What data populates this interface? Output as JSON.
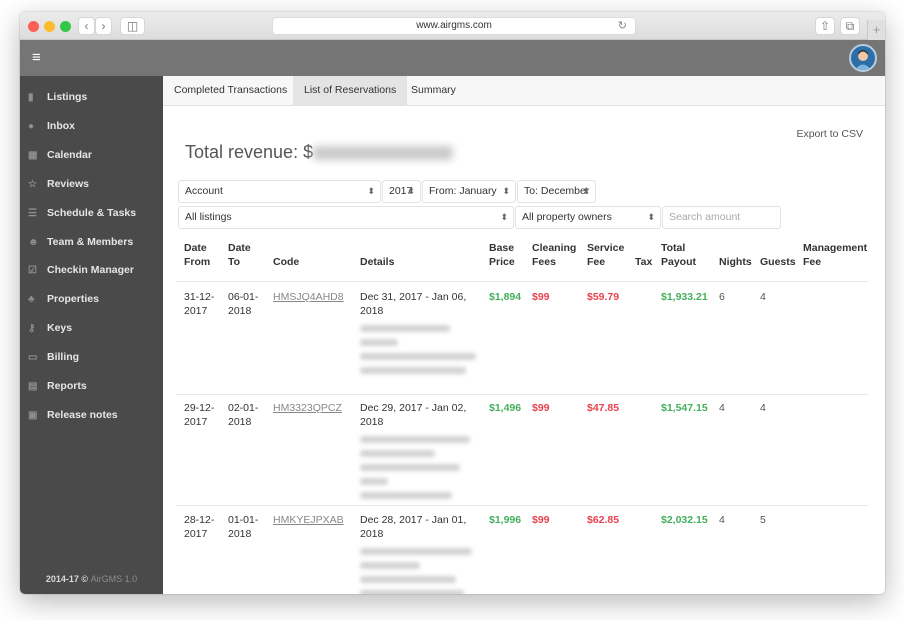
{
  "browser": {
    "url": "www.airgms.com",
    "back_icon": "chevron-left-icon",
    "forward_icon": "chevron-right-icon",
    "sidebar_icon": "sidebar-icon",
    "reload_icon": "reload-icon",
    "share_icon": "share-icon",
    "tabs_icon": "tabs-icon",
    "new_tab_label": "+"
  },
  "header": {
    "menu_icon": "≡",
    "avatar": "user-avatar"
  },
  "sidebar": {
    "items": [
      {
        "label": "Listings",
        "icon": "listings-icon",
        "glyph": "▮"
      },
      {
        "label": "Inbox",
        "icon": "inbox-icon",
        "glyph": "●"
      },
      {
        "label": "Calendar",
        "icon": "calendar-icon",
        "glyph": "▦"
      },
      {
        "label": "Reviews",
        "icon": "star-icon",
        "glyph": "☆"
      },
      {
        "label": "Schedule & Tasks",
        "icon": "tasks-icon",
        "glyph": "☰"
      },
      {
        "label": "Team & Members",
        "icon": "team-icon",
        "glyph": "☻"
      },
      {
        "label": "Checkin Manager",
        "icon": "checkin-icon",
        "glyph": "☑"
      },
      {
        "label": "Properties",
        "icon": "properties-icon",
        "glyph": "♣"
      },
      {
        "label": "Keys",
        "icon": "key-icon",
        "glyph": "⚷"
      },
      {
        "label": "Billing",
        "icon": "billing-icon",
        "glyph": "▭"
      },
      {
        "label": "Reports",
        "icon": "reports-icon",
        "glyph": "▤"
      },
      {
        "label": "Release notes",
        "icon": "release-notes-icon",
        "glyph": "▣"
      }
    ],
    "copyright": "2014-17 ©",
    "version": "AirGMS 1.0"
  },
  "tabs": [
    {
      "label": "Completed Transactions",
      "active": false
    },
    {
      "label": "List of Reservations",
      "active": true
    },
    {
      "label": "Summary",
      "active": false
    }
  ],
  "main": {
    "export_label": "Export to CSV",
    "revenue_label": "Total revenue: $"
  },
  "filters": {
    "account": "Account",
    "year": "2017",
    "from": "From: January",
    "to": "To: December",
    "listings": "All listings",
    "owners": "All property owners",
    "search_placeholder": "Search amount"
  },
  "table": {
    "headers": [
      {
        "line1": "Date",
        "line2": "From"
      },
      {
        "line1": "Date",
        "line2": "To"
      },
      {
        "line1": "",
        "line2": "Code"
      },
      {
        "line1": "",
        "line2": "Details"
      },
      {
        "line1": "Base",
        "line2": "Price"
      },
      {
        "line1": "Cleaning",
        "line2": "Fees"
      },
      {
        "line1": "Service",
        "line2": "Fee"
      },
      {
        "line1": "",
        "line2": "Tax"
      },
      {
        "line1": "Total",
        "line2": "Payout"
      },
      {
        "line1": "",
        "line2": "Nights"
      },
      {
        "line1": "",
        "line2": "Guests"
      },
      {
        "line1": "Management",
        "line2": "Fee"
      }
    ],
    "rows": [
      {
        "date_from_1": "31-12-",
        "date_from_2": "2017",
        "date_to_1": "06-01-",
        "date_to_2": "2018",
        "code": "HMSJQ4AHD8",
        "details_1": "Dec 31, 2017 - Jan 06,",
        "details_2": "2018",
        "base_price": "$1,894",
        "cleaning_fees": "$99",
        "service_fee": "$59.79",
        "tax": "",
        "total_payout": "$1,933.21",
        "nights": "6",
        "guests": "4",
        "management_fee": ""
      },
      {
        "date_from_1": "29-12-",
        "date_from_2": "2017",
        "date_to_1": "02-01-",
        "date_to_2": "2018",
        "code": "HM3323QPCZ",
        "details_1": "Dec 29, 2017 - Jan 02,",
        "details_2": "2018",
        "base_price": "$1,496",
        "cleaning_fees": "$99",
        "service_fee": "$47.85",
        "tax": "",
        "total_payout": "$1,547.15",
        "nights": "4",
        "guests": "4",
        "management_fee": ""
      },
      {
        "date_from_1": "28-12-",
        "date_from_2": "2017",
        "date_to_1": "01-01-",
        "date_to_2": "2018",
        "code": "HMKYEJPXAB",
        "details_1": "Dec 28, 2017 - Jan 01,",
        "details_2": "2018",
        "base_price": "$1,996",
        "cleaning_fees": "$99",
        "service_fee": "$62.85",
        "tax": "",
        "total_payout": "$2,032.15",
        "nights": "4",
        "guests": "5",
        "management_fee": ""
      }
    ]
  },
  "colors": {
    "positive": "#43b05c",
    "negative": "#e8424f",
    "sidebar_bg": "#4a4a4a",
    "header_bg": "#757575"
  }
}
